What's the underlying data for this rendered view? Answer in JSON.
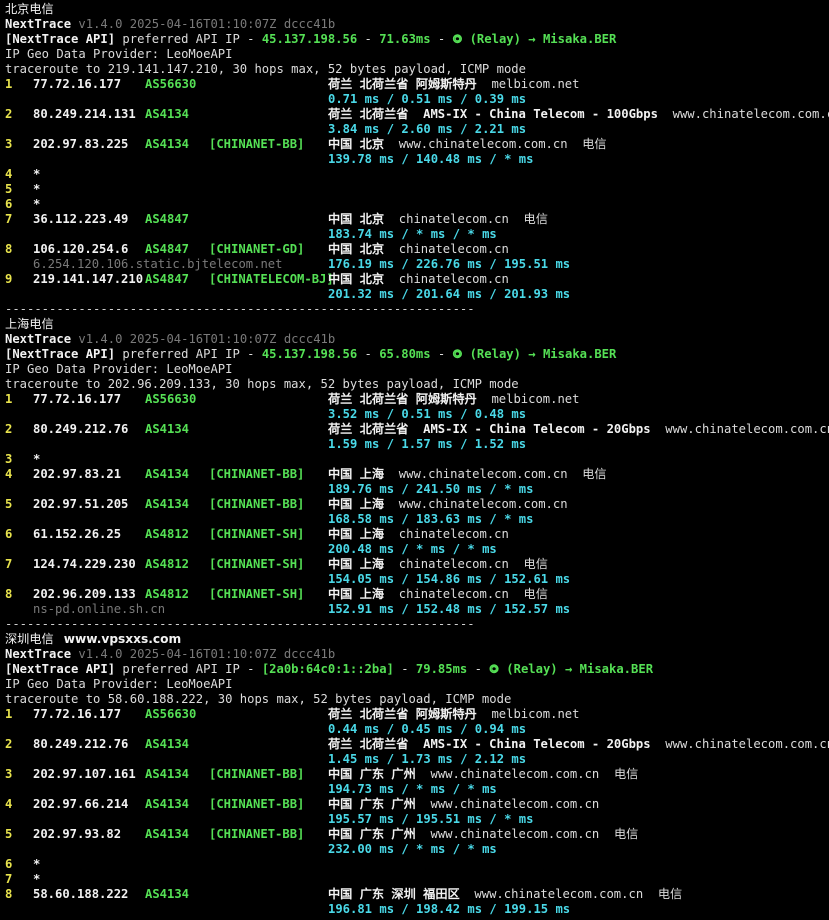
{
  "sections": [
    {
      "label": "北京电信",
      "site": "",
      "app_name": "NextTrace",
      "version_line": "v1.4.0 2025-04-16T01:10:07Z dccc41b",
      "api_prefix": "[NextTrace API]",
      "api_text": " preferred API IP - ",
      "api_ip": "45.137.198.56",
      "api_sep": " - ",
      "api_latency": "71.63ms",
      "api_sep2": " - ",
      "api_relay": "⭗ (Relay) → Misaka.BER",
      "geo_provider": "IP Geo Data Provider: LeoMoeAPI",
      "traceroute": "traceroute to 219.141.147.210, 30 hops max, 52 bytes payload, ICMP mode",
      "hops": [
        {
          "hop": "1",
          "ip": "77.72.16.177",
          "as": "AS56630",
          "tag": "",
          "geo": "荷兰 北荷兰省 阿姆斯特丹",
          "domain": "melbicom.net",
          "isp": "",
          "rtt": "0.71 ms / 0.51 ms / 0.39 ms",
          "host": ""
        },
        {
          "hop": "2",
          "ip": "80.249.214.131",
          "as": "AS4134",
          "tag": "",
          "geo": "荷兰 北荷兰省  AMS-IX - China Telecom - 100Gbps",
          "domain": "www.chinatelecom.com.cn",
          "isp": "",
          "rtt": "3.84 ms / 2.60 ms / 2.21 ms",
          "host": ""
        },
        {
          "hop": "3",
          "ip": "202.97.83.225",
          "as": "AS4134",
          "tag": "[CHINANET-BB]",
          "geo": "中国 北京",
          "domain": "www.chinatelecom.com.cn",
          "isp": "电信",
          "rtt": "139.78 ms / 140.48 ms / * ms",
          "host": ""
        },
        {
          "hop": "4",
          "ip": "*",
          "as": "",
          "tag": "",
          "geo": "",
          "domain": "",
          "isp": "",
          "rtt": "",
          "host": ""
        },
        {
          "hop": "5",
          "ip": "*",
          "as": "",
          "tag": "",
          "geo": "",
          "domain": "",
          "isp": "",
          "rtt": "",
          "host": ""
        },
        {
          "hop": "6",
          "ip": "*",
          "as": "",
          "tag": "",
          "geo": "",
          "domain": "",
          "isp": "",
          "rtt": "",
          "host": ""
        },
        {
          "hop": "7",
          "ip": "36.112.223.49",
          "as": "AS4847",
          "tag": "",
          "geo": "中国 北京",
          "domain": "chinatelecom.cn",
          "isp": "电信",
          "rtt": "183.74 ms / * ms / * ms",
          "host": ""
        },
        {
          "hop": "8",
          "ip": "106.120.254.6",
          "as": "AS4847",
          "tag": "[CHINANET-GD]",
          "geo": "中国 北京",
          "domain": "chinatelecom.cn",
          "isp": "",
          "rtt": "176.19 ms / 226.76 ms / 195.51 ms",
          "host": "6.254.120.106.static.bjtelecom.net"
        },
        {
          "hop": "9",
          "ip": "219.141.147.210",
          "as": "AS4847",
          "tag": "[CHINATELECOM-BJ]",
          "geo": "中国 北京",
          "domain": "chinatelecom.cn",
          "isp": "",
          "rtt": "201.32 ms / 201.64 ms / 201.93 ms",
          "host": ""
        }
      ]
    },
    {
      "label": "上海电信",
      "site": "",
      "app_name": "NextTrace",
      "version_line": "v1.4.0 2025-04-16T01:10:07Z dccc41b",
      "api_prefix": "[NextTrace API]",
      "api_text": " preferred API IP - ",
      "api_ip": "45.137.198.56",
      "api_sep": " - ",
      "api_latency": "65.80ms",
      "api_sep2": " - ",
      "api_relay": "⭗ (Relay) → Misaka.BER",
      "geo_provider": "IP Geo Data Provider: LeoMoeAPI",
      "traceroute": "traceroute to 202.96.209.133, 30 hops max, 52 bytes payload, ICMP mode",
      "hops": [
        {
          "hop": "1",
          "ip": "77.72.16.177",
          "as": "AS56630",
          "tag": "",
          "geo": "荷兰 北荷兰省 阿姆斯特丹",
          "domain": "melbicom.net",
          "isp": "",
          "rtt": "3.52 ms / 0.51 ms / 0.48 ms",
          "host": ""
        },
        {
          "hop": "2",
          "ip": "80.249.212.76",
          "as": "AS4134",
          "tag": "",
          "geo": "荷兰 北荷兰省  AMS-IX - China Telecom - 20Gbps",
          "domain": "www.chinatelecom.com.cn",
          "isp": "",
          "rtt": "1.59 ms / 1.57 ms / 1.52 ms",
          "host": ""
        },
        {
          "hop": "3",
          "ip": "*",
          "as": "",
          "tag": "",
          "geo": "",
          "domain": "",
          "isp": "",
          "rtt": "",
          "host": ""
        },
        {
          "hop": "4",
          "ip": "202.97.83.21",
          "as": "AS4134",
          "tag": "[CHINANET-BB]",
          "geo": "中国 上海",
          "domain": "www.chinatelecom.com.cn",
          "isp": "电信",
          "rtt": "189.76 ms / 241.50 ms / * ms",
          "host": ""
        },
        {
          "hop": "5",
          "ip": "202.97.51.205",
          "as": "AS4134",
          "tag": "[CHINANET-BB]",
          "geo": "中国 上海",
          "domain": "www.chinatelecom.com.cn",
          "isp": "",
          "rtt": "168.58 ms / 183.63 ms / * ms",
          "host": ""
        },
        {
          "hop": "6",
          "ip": "61.152.26.25",
          "as": "AS4812",
          "tag": "[CHINANET-SH]",
          "geo": "中国 上海",
          "domain": "chinatelecom.cn",
          "isp": "",
          "rtt": "200.48 ms / * ms / * ms",
          "host": ""
        },
        {
          "hop": "7",
          "ip": "124.74.229.230",
          "as": "AS4812",
          "tag": "[CHINANET-SH]",
          "geo": "中国 上海",
          "domain": "chinatelecom.cn",
          "isp": "电信",
          "rtt": "154.05 ms / 154.86 ms / 152.61 ms",
          "host": ""
        },
        {
          "hop": "8",
          "ip": "202.96.209.133",
          "as": "AS4812",
          "tag": "[CHINANET-SH]",
          "geo": "中国 上海",
          "domain": "chinatelecom.cn",
          "isp": "电信",
          "rtt": "152.91 ms / 152.48 ms / 152.57 ms",
          "host": "ns-pd.online.sh.cn"
        }
      ]
    },
    {
      "label": "深圳电信",
      "site": "www.vpsxxs.com",
      "app_name": "NextTrace",
      "version_line": "v1.4.0 2025-04-16T01:10:07Z dccc41b",
      "api_prefix": "[NextTrace API]",
      "api_text": " preferred API IP - ",
      "api_ip": "[2a0b:64c0:1::2ba]",
      "api_sep": " - ",
      "api_latency": "79.85ms",
      "api_sep2": " - ",
      "api_relay": "⭗ (Relay) → Misaka.BER",
      "geo_provider": "IP Geo Data Provider: LeoMoeAPI",
      "traceroute": "traceroute to 58.60.188.222, 30 hops max, 52 bytes payload, ICMP mode",
      "hops": [
        {
          "hop": "1",
          "ip": "77.72.16.177",
          "as": "AS56630",
          "tag": "",
          "geo": "荷兰 北荷兰省 阿姆斯特丹",
          "domain": "melbicom.net",
          "isp": "",
          "rtt": "0.44 ms / 0.45 ms / 0.94 ms",
          "host": ""
        },
        {
          "hop": "2",
          "ip": "80.249.212.76",
          "as": "AS4134",
          "tag": "",
          "geo": "荷兰 北荷兰省  AMS-IX - China Telecom - 20Gbps",
          "domain": "www.chinatelecom.com.cn",
          "isp": "",
          "rtt": "1.45 ms / 1.73 ms / 2.12 ms",
          "host": ""
        },
        {
          "hop": "3",
          "ip": "202.97.107.161",
          "as": "AS4134",
          "tag": "[CHINANET-BB]",
          "geo": "中国 广东 广州",
          "domain": "www.chinatelecom.com.cn",
          "isp": "电信",
          "rtt": "194.73 ms / * ms / * ms",
          "host": ""
        },
        {
          "hop": "4",
          "ip": "202.97.66.214",
          "as": "AS4134",
          "tag": "[CHINANET-BB]",
          "geo": "中国 广东 广州",
          "domain": "www.chinatelecom.com.cn",
          "isp": "",
          "rtt": "195.57 ms / 195.51 ms / * ms",
          "host": ""
        },
        {
          "hop": "5",
          "ip": "202.97.93.82",
          "as": "AS4134",
          "tag": "[CHINANET-BB]",
          "geo": "中国 广东 广州",
          "domain": "www.chinatelecom.com.cn",
          "isp": "电信",
          "rtt": "232.00 ms / * ms / * ms",
          "host": ""
        },
        {
          "hop": "6",
          "ip": "*",
          "as": "",
          "tag": "",
          "geo": "",
          "domain": "",
          "isp": "",
          "rtt": "",
          "host": ""
        },
        {
          "hop": "7",
          "ip": "*",
          "as": "",
          "tag": "",
          "geo": "",
          "domain": "",
          "isp": "",
          "rtt": "",
          "host": ""
        },
        {
          "hop": "8",
          "ip": "58.60.188.222",
          "as": "AS4134",
          "tag": "",
          "geo": "中国 广东 深圳 福田区",
          "domain": "www.chinatelecom.com.cn",
          "isp": "电信",
          "rtt": "196.81 ms / 198.42 ms / 199.15 ms",
          "host": ""
        }
      ]
    }
  ],
  "separator": "----------------------------------------------------------------",
  "colors": {
    "background": "#000000",
    "hop_number": "#e8e34d",
    "asn": "#55e055",
    "tag": "#55e055",
    "api_ip": "#55e055",
    "rtt": "#4ad9e8",
    "version": "#7a7a7a",
    "host": "#7a7a7a"
  }
}
